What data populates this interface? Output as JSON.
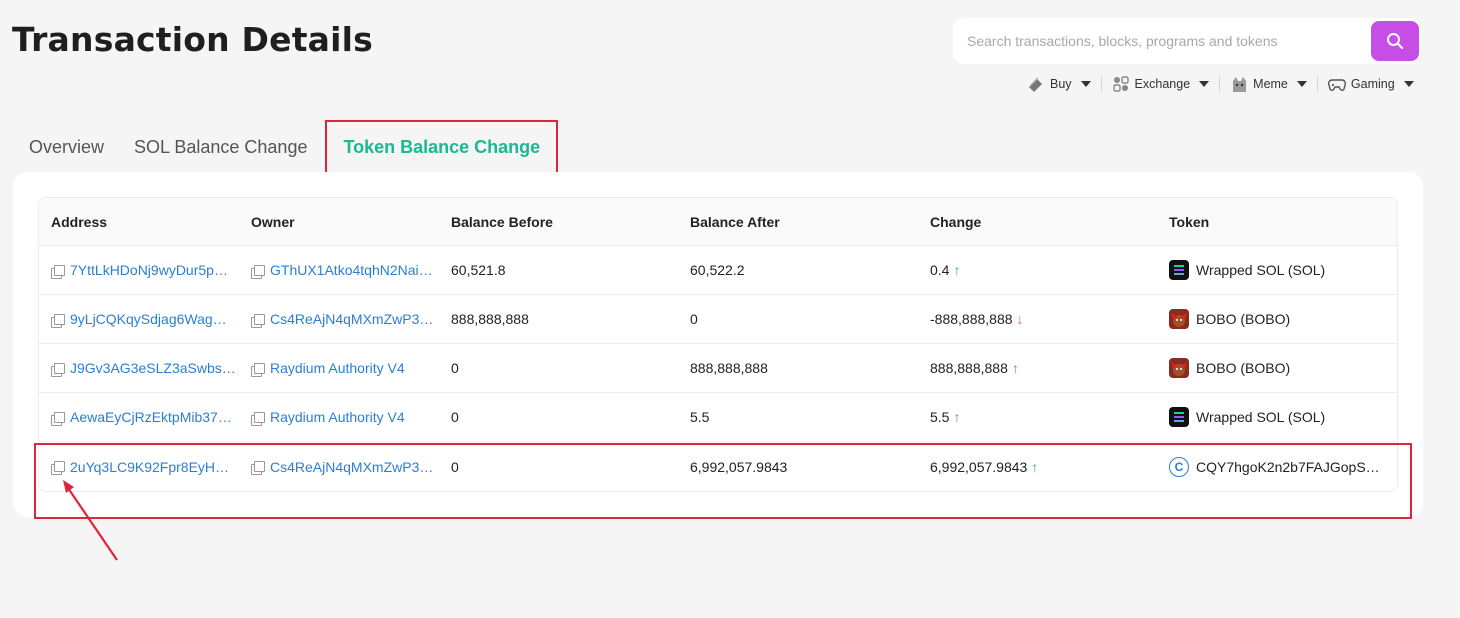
{
  "page": {
    "title": "Transaction Details"
  },
  "search": {
    "placeholder": "Search transactions, blocks, programs and tokens",
    "value": ""
  },
  "nav": [
    {
      "label": "Buy",
      "icon": "buy-icon"
    },
    {
      "label": "Exchange",
      "icon": "exchange-icon"
    },
    {
      "label": "Meme",
      "icon": "meme-icon"
    },
    {
      "label": "Gaming",
      "icon": "gamepad-icon"
    }
  ],
  "tabs": [
    {
      "label": "Overview",
      "active": false
    },
    {
      "label": "SOL Balance Change",
      "active": false
    },
    {
      "label": "Token Balance Change",
      "active": true
    }
  ],
  "table": {
    "headers": [
      "Address",
      "Owner",
      "Balance Before",
      "Balance After",
      "Change",
      "Token"
    ],
    "rows": [
      {
        "address": "7YttLkHDoNj9wyDur5p…",
        "owner": "GThUX1Atko4tqhN2Nai…",
        "before": "60,521.8",
        "after": "60,522.2",
        "change": "0.4",
        "direction": "up",
        "token": "Wrapped SOL (SOL)",
        "token_icon": "solana-icon"
      },
      {
        "address": "9yLjCQKqySdjag6Wag…",
        "owner": "Cs4ReAjN4qMXmZwP3…",
        "before": "888,888,888",
        "after": "0",
        "change": "-888,888,888",
        "direction": "down",
        "token": "BOBO (BOBO)",
        "token_icon": "bobo-icon"
      },
      {
        "address": "J9Gv3AG3eSLZ3aSwbs…",
        "owner": "Raydium Authority V4",
        "before": "0",
        "after": "888,888,888",
        "change": "888,888,888",
        "direction": "up",
        "token": "BOBO (BOBO)",
        "token_icon": "bobo-icon"
      },
      {
        "address": "AewaEyCjRzEktpMib37…",
        "owner": "Raydium Authority V4",
        "before": "0",
        "after": "5.5",
        "change": "5.5",
        "direction": "up",
        "token": "Wrapped SOL (SOL)",
        "token_icon": "solana-icon"
      },
      {
        "address": "2uYq3LC9K92Fpr8EyH…",
        "owner": "Cs4ReAjN4qMXmZwP3…",
        "before": "0",
        "after": "6,992,057.9843",
        "change": "6,992,057.9843",
        "direction": "up",
        "token": "CQY7hgoK2n2b7FAJGopSh…",
        "token_icon": "c-token-icon"
      }
    ]
  },
  "colors": {
    "accent": "#c64ee6",
    "active_tab": "#19b992",
    "link": "#2a7fd4",
    "up": "#35b84a",
    "down": "#e2643a",
    "annotation": "#e0243b"
  }
}
